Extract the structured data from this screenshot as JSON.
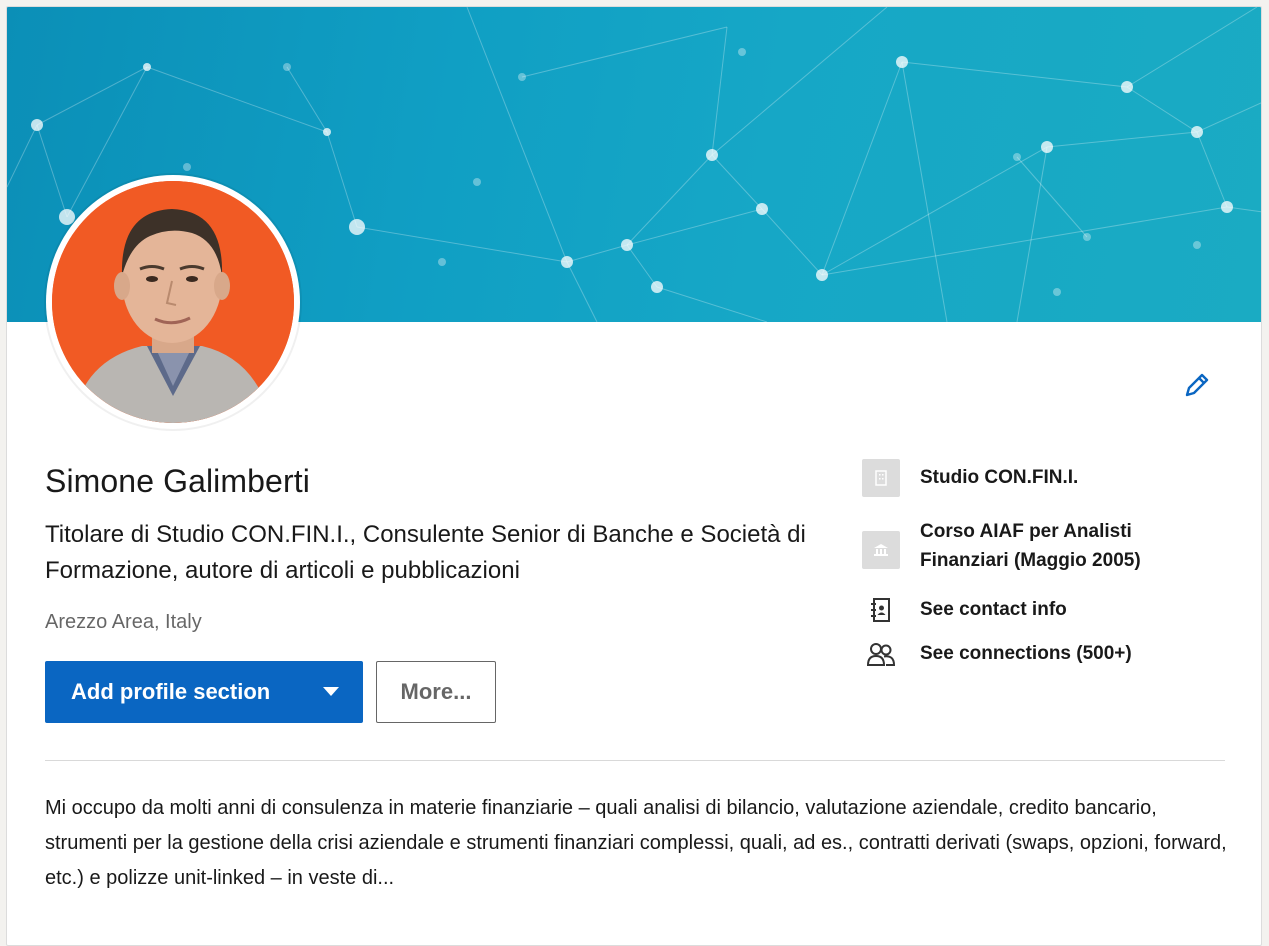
{
  "profile": {
    "name": "Simone Galimberti",
    "headline": "Titolare di Studio CON.FIN.I., Consulente Senior di Banche e Società di Formazione, autore di articoli e pubblicazioni",
    "location": "Arezzo Area, Italy",
    "avatar_bg_color": "#f15a24"
  },
  "actions": {
    "add_profile_section": "Add profile section",
    "more": "More..."
  },
  "side": {
    "company": "Studio CON.FIN.I.",
    "education": "Corso AIAF per Analisti Finanziari (Maggio 2005)",
    "contact": "See contact info",
    "connections": "See connections (500+)"
  },
  "summary": {
    "text": "Mi occupo da molti anni di consulenza in materie finanziarie – quali analisi di bilancio, valutazione aziendale, credito bancario, strumenti per la gestione della crisi aziendale e strumenti finanziari complessi, quali, ad es., contratti derivati (swaps, opzioni, forward, etc.) e polizze unit-linked – in veste di..."
  },
  "colors": {
    "accent": "#0a66c2",
    "banner": "#0b8fb7"
  },
  "icons": [
    "network-banner",
    "pencil-icon",
    "building-icon",
    "school-icon",
    "contact-book-icon",
    "people-icon",
    "caret-down-icon"
  ]
}
